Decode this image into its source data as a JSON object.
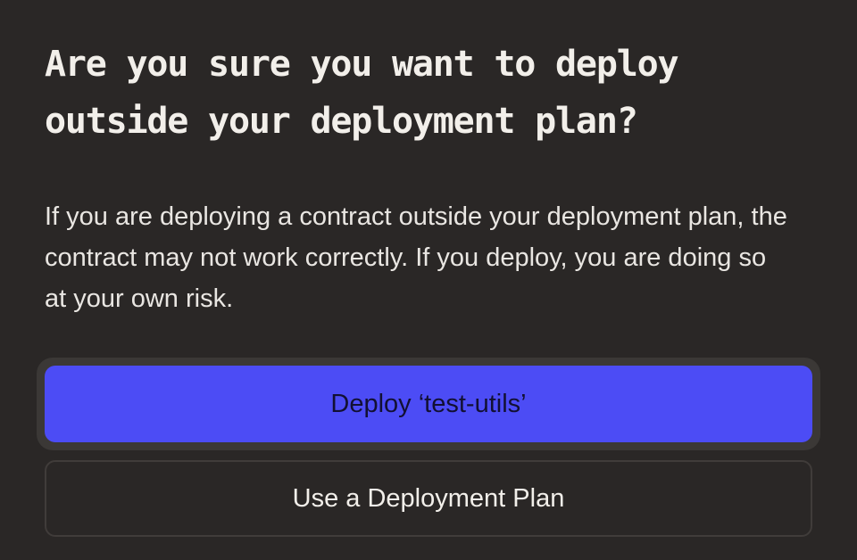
{
  "dialog": {
    "title": "Are you sure you want to deploy outside your deployment plan?",
    "message": "If you are deploying a contract outside your deployment plan, the contract may not work correctly. If you deploy, you are doing so at your own risk.",
    "primary_button_label": "Deploy ‘test-utils’",
    "secondary_button_label": "Use a Deployment Plan"
  },
  "colors": {
    "background": "#2a2726",
    "primary_button": "#4c4cf5",
    "text": "#f2efea"
  }
}
